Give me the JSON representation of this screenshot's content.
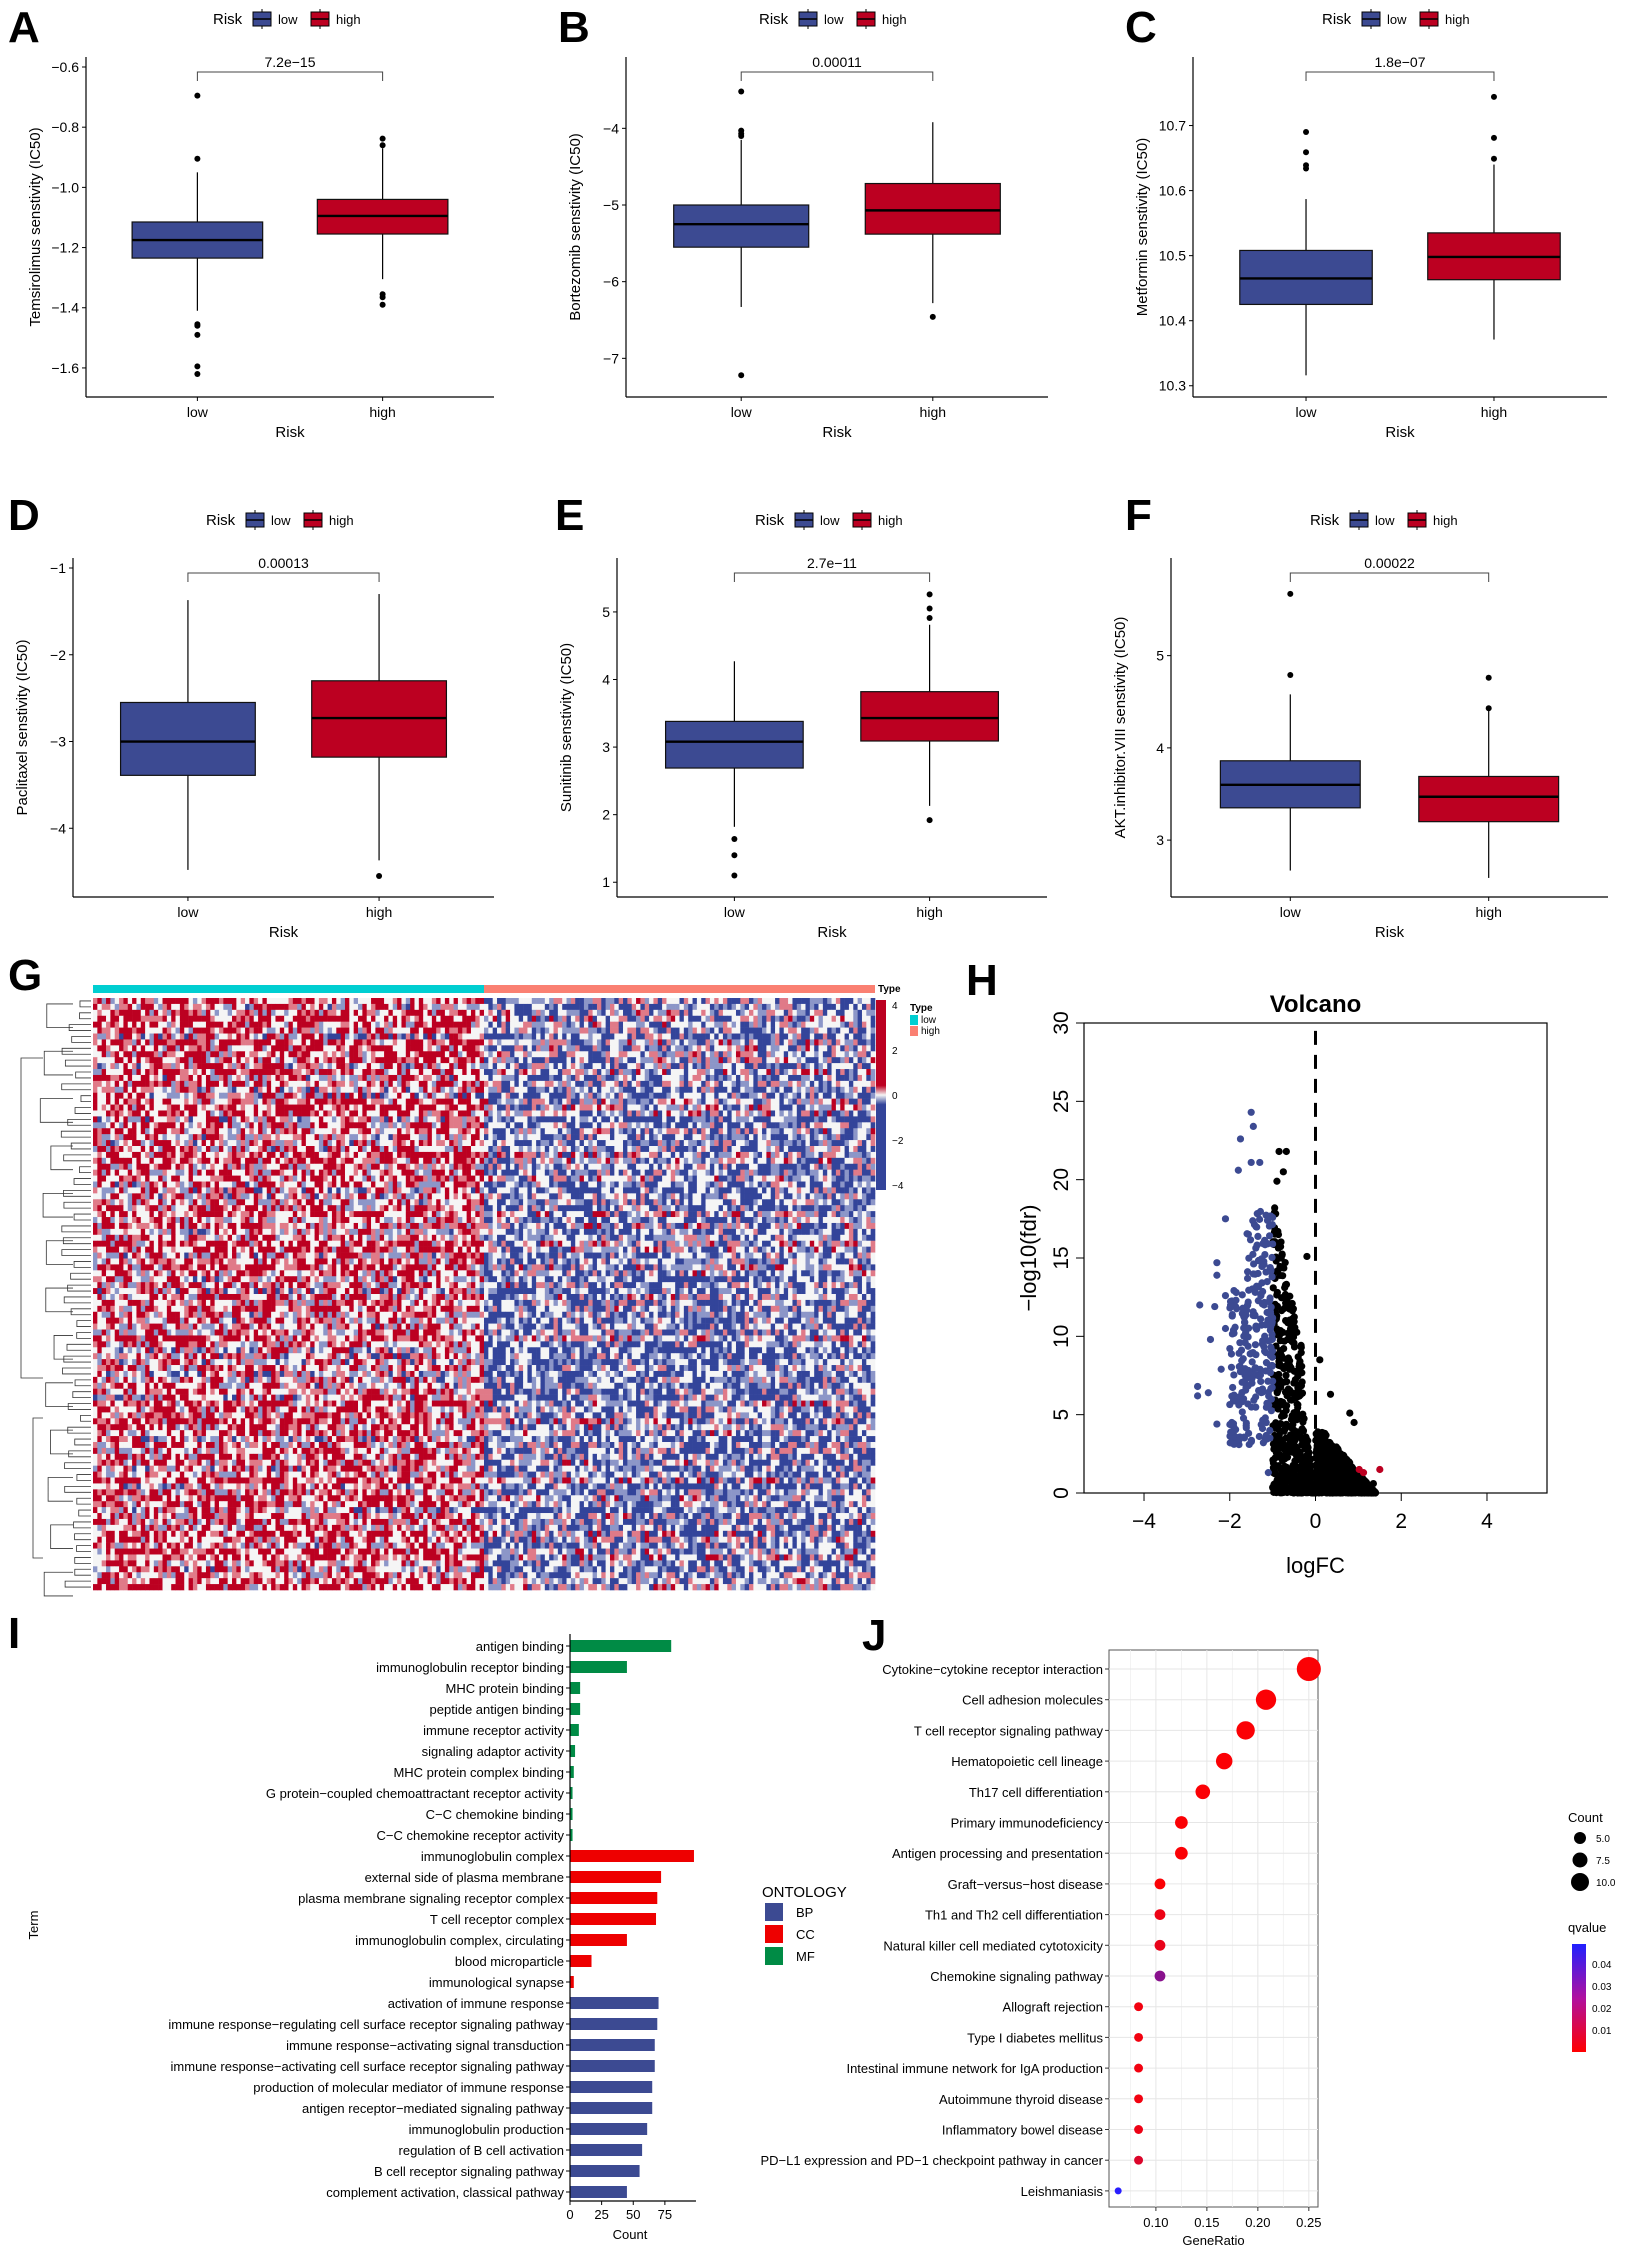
{
  "figure": {
    "colors": {
      "low": "#3C4A92",
      "high": "#BC0021",
      "bp": "#3C4A92",
      "cc": "#EE0000",
      "mf": "#008B45",
      "type_low": "#00CED1",
      "type_high": "#FA8072",
      "heat_high": "#BC0021",
      "heat_mid": "#F5F5F5",
      "heat_low": "#33449A",
      "grid": "#E6E6E6"
    }
  },
  "chart_data": [
    {
      "panel": "A",
      "type": "box",
      "legend_title": "Risk",
      "legend_entries": [
        "low",
        "high"
      ],
      "categories": [
        "low",
        "high"
      ],
      "xlabel": "Risk",
      "ylabel": "Temsirolimus senstivity (IC50)",
      "ylim": [
        -1.67,
        -0.6
      ],
      "yticks": [
        -0.6,
        -0.8,
        -1.0,
        -1.2,
        -1.4,
        -1.6
      ],
      "ytick_labels": [
        "−0.6",
        "−0.8",
        "−1.0",
        "−1.2",
        "−1.4",
        "−1.6"
      ],
      "pvalue": "7.2e−15",
      "series": [
        {
          "name": "low",
          "whisker_low": -1.41,
          "q1": -1.235,
          "median": -1.175,
          "q3": -1.115,
          "whisker_high": -0.95,
          "outliers": [
            -0.695,
            -0.905,
            -1.455,
            -1.46,
            -1.49,
            -1.595,
            -1.62
          ]
        },
        {
          "name": "high",
          "whisker_low": -1.305,
          "q1": -1.155,
          "median": -1.095,
          "q3": -1.04,
          "whisker_high": -0.87,
          "outliers": [
            -0.838,
            -0.86,
            -1.355,
            -1.365,
            -1.39
          ]
        }
      ]
    },
    {
      "panel": "B",
      "type": "box",
      "legend_title": "Risk",
      "legend_entries": [
        "low",
        "high"
      ],
      "categories": [
        "low",
        "high"
      ],
      "xlabel": "Risk",
      "ylabel": "Bortezomib senstivity (IC50)",
      "ylim": [
        -7.4,
        -3.2
      ],
      "yticks": [
        -4,
        -5,
        -6,
        -7
      ],
      "ytick_labels": [
        "−4",
        "−5",
        "−6",
        "−7"
      ],
      "pvalue": "0.00011",
      "series": [
        {
          "name": "low",
          "whisker_low": -6.33,
          "q1": -5.55,
          "median": -5.25,
          "q3": -5.0,
          "whisker_high": -4.15,
          "outliers": [
            -3.52,
            -4.03,
            -4.07,
            -4.1,
            -7.22
          ]
        },
        {
          "name": "high",
          "whisker_low": -6.28,
          "q1": -5.38,
          "median": -5.07,
          "q3": -4.72,
          "whisker_high": -3.92,
          "outliers": [
            -6.46
          ]
        }
      ]
    },
    {
      "panel": "C",
      "type": "box",
      "legend_title": "Risk",
      "legend_entries": [
        "low",
        "high"
      ],
      "categories": [
        "low",
        "high"
      ],
      "xlabel": "Risk",
      "ylabel": "Metformin senstivity (IC50)",
      "ylim": [
        10.295,
        10.79
      ],
      "yticks": [
        10.3,
        10.4,
        10.5,
        10.6,
        10.7
      ],
      "ytick_labels": [
        "10.3",
        "10.4",
        "10.5",
        "10.6",
        "10.7"
      ],
      "pvalue": "1.8e−07",
      "series": [
        {
          "name": "low",
          "whisker_low": 10.316,
          "q1": 10.425,
          "median": 10.465,
          "q3": 10.508,
          "whisker_high": 10.587,
          "outliers": [
            10.69,
            10.659,
            10.639,
            10.634
          ]
        },
        {
          "name": "high",
          "whisker_low": 10.371,
          "q1": 10.463,
          "median": 10.498,
          "q3": 10.535,
          "whisker_high": 10.64,
          "outliers": [
            10.744,
            10.681,
            10.649
          ]
        }
      ]
    },
    {
      "panel": "D",
      "type": "box",
      "legend_title": "Risk",
      "legend_entries": [
        "low",
        "high"
      ],
      "categories": [
        "low",
        "high"
      ],
      "xlabel": "Risk",
      "ylabel": "Paclitaxel senstivity (IC50)",
      "ylim": [
        -4.7,
        -1.0
      ],
      "yticks": [
        -1,
        -2,
        -3,
        -4
      ],
      "ytick_labels": [
        "−1",
        "−2",
        "−3",
        "−4"
      ],
      "pvalue": "0.00013",
      "series": [
        {
          "name": "low",
          "whisker_low": -4.48,
          "q1": -3.39,
          "median": -3.0,
          "q3": -2.55,
          "whisker_high": -1.37,
          "outliers": []
        },
        {
          "name": "high",
          "whisker_low": -4.37,
          "q1": -3.18,
          "median": -2.73,
          "q3": -2.3,
          "whisker_high": -1.3,
          "outliers": [
            -4.55
          ]
        }
      ]
    },
    {
      "panel": "E",
      "type": "box",
      "legend_title": "Risk",
      "legend_entries": [
        "low",
        "high"
      ],
      "categories": [
        "low",
        "high"
      ],
      "xlabel": "Risk",
      "ylabel": "Sunitinib senstivity (IC50)",
      "ylim": [
        0.9,
        5.65
      ],
      "yticks": [
        1,
        2,
        3,
        4,
        5
      ],
      "ytick_labels": [
        "1",
        "2",
        "3",
        "4",
        "5"
      ],
      "pvalue": "2.7e−11",
      "series": [
        {
          "name": "low",
          "whisker_low": 1.82,
          "q1": 2.69,
          "median": 3.08,
          "q3": 3.38,
          "whisker_high": 4.27,
          "outliers": [
            1.64,
            1.4,
            1.1
          ]
        },
        {
          "name": "high",
          "whisker_low": 2.13,
          "q1": 3.09,
          "median": 3.43,
          "q3": 3.82,
          "whisker_high": 4.81,
          "outliers": [
            5.26,
            5.05,
            4.91,
            1.92
          ]
        }
      ]
    },
    {
      "panel": "F",
      "type": "box",
      "legend_title": "Risk",
      "legend_entries": [
        "low",
        "high"
      ],
      "categories": [
        "low",
        "high"
      ],
      "xlabel": "Risk",
      "ylabel": "AKT.inhibitor.VIII senstivity (IC50)",
      "ylim": [
        2.47,
        5.95
      ],
      "yticks": [
        3,
        4,
        5
      ],
      "ytick_labels": [
        "3",
        "4",
        "5"
      ],
      "pvalue": "0.00022",
      "series": [
        {
          "name": "low",
          "whisker_low": 2.67,
          "q1": 3.35,
          "median": 3.6,
          "q3": 3.86,
          "whisker_high": 4.58,
          "outliers": [
            5.67,
            4.79
          ]
        },
        {
          "name": "high",
          "whisker_low": 2.59,
          "q1": 3.2,
          "median": 3.47,
          "q3": 3.69,
          "whisker_high": 4.41,
          "outliers": [
            4.76,
            4.43
          ]
        }
      ]
    },
    {
      "panel": "G",
      "type": "heatmap",
      "annotation_title": "Type",
      "annotation_groups": [
        "low",
        "high"
      ],
      "annotation_split": 0.5,
      "colorbar_ticks": [
        4,
        2,
        0,
        -2,
        -4
      ],
      "colorbar_labels": [
        "4",
        "2",
        "0",
        "−2",
        "−4"
      ],
      "legend_title": "Type",
      "legend_entries": [
        "low",
        "high"
      ],
      "n_rows": 100,
      "n_cols": 180,
      "pattern": "low-risk samples predominantly high (red), high-risk samples predominantly low (blue)"
    },
    {
      "panel": "H",
      "type": "scatter",
      "title": "Volcano",
      "xlabel": "logFC",
      "ylabel": "−log10(fdr)",
      "xlim": [
        -5.4,
        5.4
      ],
      "ylim": [
        0,
        30
      ],
      "xticks": [
        -4,
        -2,
        0,
        2,
        4
      ],
      "xtick_labels": [
        "−4",
        "−2",
        "0",
        "2",
        "4"
      ],
      "yticks": [
        0,
        5,
        10,
        15,
        20,
        25,
        30
      ],
      "ytick_labels": [
        "0",
        "5",
        "10",
        "15",
        "20",
        "25",
        "30"
      ],
      "vline": 0,
      "groups": [
        {
          "name": "down",
          "color_key": "low",
          "logfc_range": [
            -2.8,
            -1.0
          ],
          "fdr_range": [
            1.3,
            24.4
          ],
          "highlight_points": [
            [
              -1.5,
              24.3
            ],
            [
              -1.45,
              23.4
            ],
            [
              -1.75,
              22.6
            ],
            [
              -1.8,
              20.6
            ],
            [
              -1.5,
              21.1
            ],
            [
              -1.3,
              21.1
            ],
            [
              -2.1,
              17.5
            ],
            [
              -2.3,
              14.7
            ],
            [
              -2.3,
              13.9
            ],
            [
              -2.7,
              12.0
            ],
            [
              -2.35,
              11.9
            ],
            [
              -2.1,
              12.6
            ],
            [
              -1.85,
              12.8
            ],
            [
              -2.1,
              10.5
            ],
            [
              -2.45,
              9.8
            ],
            [
              -2.75,
              6.8
            ],
            [
              -2.75,
              6.2
            ],
            [
              -2.5,
              6.4
            ],
            [
              -2.2,
              7.9
            ],
            [
              -2.3,
              4.4
            ],
            [
              -1.1,
              1.3
            ]
          ]
        },
        {
          "name": "not-significant",
          "color_key": "black",
          "logfc_range": [
            -1.0,
            1.4
          ],
          "fdr_range": [
            0,
            21.8
          ],
          "highlight_points": [
            [
              -0.85,
              21.8
            ],
            [
              -0.68,
              21.8
            ],
            [
              -0.75,
              20.5
            ],
            [
              -0.9,
              19.9
            ],
            [
              -0.2,
              15.1
            ],
            [
              0.1,
              8.5
            ],
            [
              0.35,
              6.3
            ],
            [
              0.8,
              5.1
            ],
            [
              0.9,
              4.5
            ],
            [
              1.35,
              0.6
            ]
          ]
        },
        {
          "name": "up",
          "color_key": "high",
          "points": [
            [
              1.02,
              1.5
            ],
            [
              1.12,
              1.3
            ],
            [
              1.5,
              1.5
            ]
          ]
        }
      ]
    },
    {
      "panel": "I",
      "type": "bar",
      "orientation": "horizontal",
      "xlabel": "Count",
      "ylabel": "Term",
      "xlim": [
        0,
        98
      ],
      "xticks": [
        0,
        25,
        50,
        75
      ],
      "xtick_labels": [
        "0",
        "25",
        "50",
        "75"
      ],
      "legend_title": "ONTOLOGY",
      "legend_entries": [
        {
          "label": "BP",
          "color_key": "bp"
        },
        {
          "label": "CC",
          "color_key": "cc"
        },
        {
          "label": "MF",
          "color_key": "mf"
        }
      ],
      "categories": [
        {
          "term": "antigen binding",
          "ontology": "MF",
          "count": 80
        },
        {
          "term": "immunoglobulin receptor binding",
          "ontology": "MF",
          "count": 45
        },
        {
          "term": "MHC protein binding",
          "ontology": "MF",
          "count": 8
        },
        {
          "term": "peptide antigen binding",
          "ontology": "MF",
          "count": 8
        },
        {
          "term": "immune receptor activity",
          "ontology": "MF",
          "count": 7
        },
        {
          "term": "signaling adaptor activity",
          "ontology": "MF",
          "count": 4
        },
        {
          "term": "MHC protein complex binding",
          "ontology": "MF",
          "count": 3
        },
        {
          "term": "G protein−coupled chemoattractant receptor activity",
          "ontology": "MF",
          "count": 2
        },
        {
          "term": "C−C chemokine binding",
          "ontology": "MF",
          "count": 2
        },
        {
          "term": "C−C chemokine receptor activity",
          "ontology": "MF",
          "count": 2
        },
        {
          "term": "immunoglobulin complex",
          "ontology": "CC",
          "count": 98
        },
        {
          "term": "external side of plasma membrane",
          "ontology": "CC",
          "count": 72
        },
        {
          "term": "plasma membrane signaling receptor complex",
          "ontology": "CC",
          "count": 69
        },
        {
          "term": "T cell receptor complex",
          "ontology": "CC",
          "count": 68
        },
        {
          "term": "immunoglobulin complex, circulating",
          "ontology": "CC",
          "count": 45
        },
        {
          "term": "blood microparticle",
          "ontology": "CC",
          "count": 17
        },
        {
          "term": "immunological synapse",
          "ontology": "CC",
          "count": 3
        },
        {
          "term": "activation of immune response",
          "ontology": "BP",
          "count": 70
        },
        {
          "term": "immune response−regulating cell surface receptor signaling pathway",
          "ontology": "BP",
          "count": 69
        },
        {
          "term": "immune response−activating signal transduction",
          "ontology": "BP",
          "count": 67
        },
        {
          "term": "immune response−activating cell surface receptor signaling pathway",
          "ontology": "BP",
          "count": 67
        },
        {
          "term": "production of molecular mediator of immune response",
          "ontology": "BP",
          "count": 65
        },
        {
          "term": "antigen receptor−mediated signaling pathway",
          "ontology": "BP",
          "count": 65
        },
        {
          "term": "immunoglobulin production",
          "ontology": "BP",
          "count": 61
        },
        {
          "term": "regulation of B cell activation",
          "ontology": "BP",
          "count": 57
        },
        {
          "term": "B cell receptor signaling pathway",
          "ontology": "BP",
          "count": 55
        },
        {
          "term": "complement activation, classical pathway",
          "ontology": "BP",
          "count": 45
        }
      ]
    },
    {
      "panel": "J",
      "type": "scatter",
      "subtype": "dotplot",
      "xlabel": "GeneRatio",
      "xlim": [
        0.054,
        0.259
      ],
      "xticks": [
        0.1,
        0.15,
        0.2,
        0.25
      ],
      "xtick_labels": [
        "0.10",
        "0.15",
        "0.20",
        "0.25"
      ],
      "grid": true,
      "size_legend_title": "Count",
      "size_legend": [
        5.0,
        7.5,
        10.0
      ],
      "size_legend_labels": [
        "5.0",
        "7.5",
        "10.0"
      ],
      "color_legend_title": "qvalue",
      "color_legend_ticks": [
        0.04,
        0.03,
        0.02,
        0.01
      ],
      "color_legend_labels": [
        "0.04",
        "0.03",
        "0.02",
        "0.01"
      ],
      "color_range": [
        0.0,
        0.049
      ],
      "points": [
        {
          "term": "Cytokine−cytokine receptor interaction",
          "gene_ratio": 0.25,
          "count": 12,
          "qvalue": 0.001
        },
        {
          "term": "Cell adhesion molecules",
          "gene_ratio": 0.208,
          "count": 10,
          "qvalue": 0.001
        },
        {
          "term": "T cell receptor signaling pathway",
          "gene_ratio": 0.188,
          "count": 9,
          "qvalue": 0.001
        },
        {
          "term": "Hematopoietic cell lineage",
          "gene_ratio": 0.167,
          "count": 8,
          "qvalue": 0.001
        },
        {
          "term": "Th17 cell differentiation",
          "gene_ratio": 0.146,
          "count": 7,
          "qvalue": 0.001
        },
        {
          "term": "Primary immunodeficiency",
          "gene_ratio": 0.125,
          "count": 6,
          "qvalue": 0.001
        },
        {
          "term": "Antigen processing and presentation",
          "gene_ratio": 0.125,
          "count": 6,
          "qvalue": 0.001
        },
        {
          "term": "Graft−versus−host disease",
          "gene_ratio": 0.104,
          "count": 5,
          "qvalue": 0.001
        },
        {
          "term": "Th1 and Th2 cell differentiation",
          "gene_ratio": 0.104,
          "count": 5,
          "qvalue": 0.004
        },
        {
          "term": "Natural killer cell mediated cytotoxicity",
          "gene_ratio": 0.104,
          "count": 5,
          "qvalue": 0.005
        },
        {
          "term": "Chemokine signaling pathway",
          "gene_ratio": 0.104,
          "count": 5,
          "qvalue": 0.027
        },
        {
          "term": "Allograft rejection",
          "gene_ratio": 0.083,
          "count": 4,
          "qvalue": 0.003
        },
        {
          "term": "Type I diabetes mellitus",
          "gene_ratio": 0.083,
          "count": 4,
          "qvalue": 0.003
        },
        {
          "term": "Intestinal immune network for IgA production",
          "gene_ratio": 0.083,
          "count": 4,
          "qvalue": 0.003
        },
        {
          "term": "Autoimmune thyroid disease",
          "gene_ratio": 0.083,
          "count": 4,
          "qvalue": 0.003
        },
        {
          "term": "Inflammatory bowel disease",
          "gene_ratio": 0.083,
          "count": 4,
          "qvalue": 0.004
        },
        {
          "term": "PD−L1 expression and PD−1 checkpoint pathway in cancer",
          "gene_ratio": 0.083,
          "count": 4,
          "qvalue": 0.008
        },
        {
          "term": "Leishmaniasis",
          "gene_ratio": 0.063,
          "count": 3,
          "qvalue": 0.049
        }
      ]
    }
  ]
}
